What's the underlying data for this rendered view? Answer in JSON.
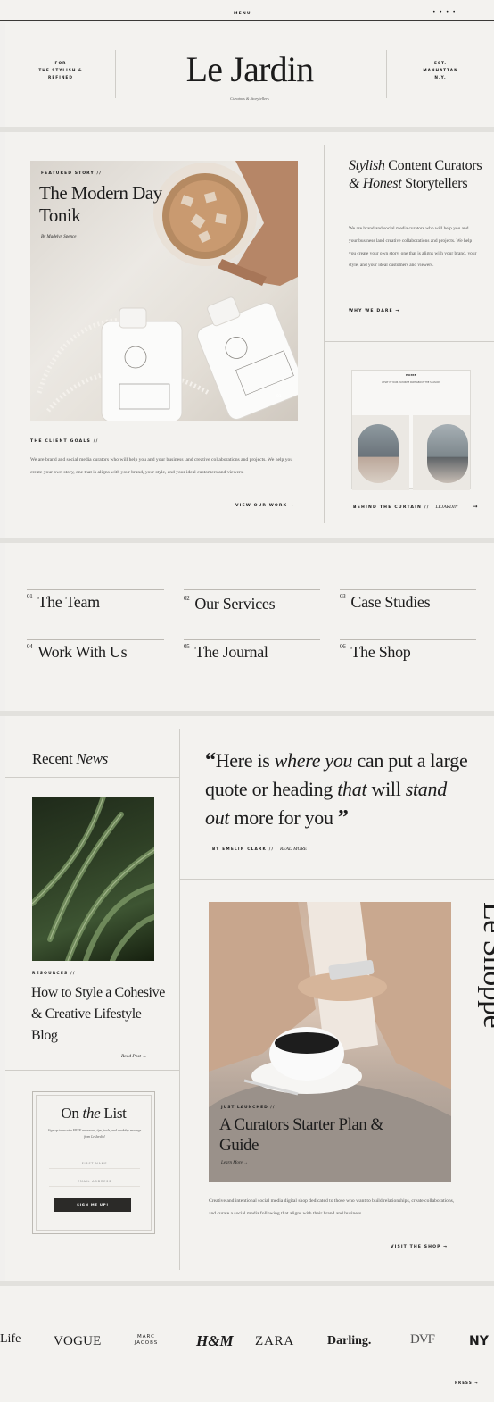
{
  "topbar": {
    "menu": "MENU",
    "dots": "•  •  •  •"
  },
  "header": {
    "left_tag": [
      "FOR",
      "THE STYLISH &",
      "REFINED"
    ],
    "brand": "Le Jardin",
    "tagline": "Curators & Storytellers",
    "right_tag": [
      "EST.",
      "MANHATTAN",
      "N.Y."
    ]
  },
  "featured": {
    "kicker": "FEATURED STORY //",
    "title": "The Modern Day Tonik",
    "author": "By Madelyn Spence",
    "counter": "01",
    "goals_label": "THE CLIENT GOALS //",
    "goals_body": "We are brand and social media curators who will help you and your business land creative collaborations and projects. We help you create your own story, one that is aligns with your brand, your style, and your ideal customers and viewers.",
    "cta": "VIEW OUR WORK →"
  },
  "about": {
    "title_italic": "Stylish",
    "title_rest": "Content Curators",
    "amp": "&",
    "honest": "Honest",
    "storytellers": "Storytellers",
    "body": "We are brand and social media curators who will help you and your business land creative collaborations and projects. We help you create your own story, one that is aligns with your brand, your style, and your ideal customers and viewers.",
    "cta": "WHY WE DARE →"
  },
  "behind": {
    "screen_title": "HOME",
    "screen_line": "WHAT IS YOUR FAVORITE PART ABOUT THE SEASON?",
    "label": "BEHIND THE CURTAIN //",
    "handle": "Lejardin",
    "arrow": "→"
  },
  "nav": [
    {
      "num": "01",
      "label": "The Team"
    },
    {
      "num": "02",
      "label": "Our Services"
    },
    {
      "num": "03",
      "label": "Case Studies"
    },
    {
      "num": "04",
      "label": "Work With Us"
    },
    {
      "num": "05",
      "label": "The Journal"
    },
    {
      "num": "06",
      "label": "The Shop"
    }
  ],
  "news": {
    "heading_plain": "Recent",
    "heading_italic": "News",
    "kicker": "RESOURCES //",
    "title": "How to Style a Cohesive & Creative Lifestyle Blog",
    "read": "Read Post →"
  },
  "quote": {
    "open": "“",
    "p1": "Here is",
    "i1": "where you",
    "p2": "can put a large quote or heading",
    "i2": "that",
    "p3": "will",
    "i3": "stand out",
    "p4": "more for you",
    "close": "”",
    "byline": "BY EMELIN CLARK //",
    "more": "Read More"
  },
  "newsletter": {
    "title_plain": "On",
    "title_italic": "the",
    "title_end": "List",
    "blurb": "Sign up to receive FREE resources, tips, tools, and weekday musings from Le Jardin!",
    "first_name": "FIRST NAME",
    "email": "EMAIL ADDRESS",
    "button": "SIGN ME UP!"
  },
  "shop": {
    "vertical": "Le Shoppe",
    "kicker": "JUST LAUNCHED //",
    "title": "A Curators Starter Plan & Guide",
    "learn": "Learn More →",
    "body": "Creative and intentional social media digital shop dedicated to those who want to build relationships, create collaborations, and curate a social media following that aligns with their brand and business.",
    "cta": "VISIT THE SHOP →"
  },
  "press": {
    "logos": [
      "Life",
      "VOGUE",
      "MARC JACOBS",
      "H&M",
      "ZARA",
      "Darling.",
      "DVF",
      "NY"
    ],
    "cta": "PRESS →"
  },
  "colors": {
    "bg": "#f3f2ef",
    "gap": "#e2e1dd",
    "dark": "#2b2a28"
  }
}
